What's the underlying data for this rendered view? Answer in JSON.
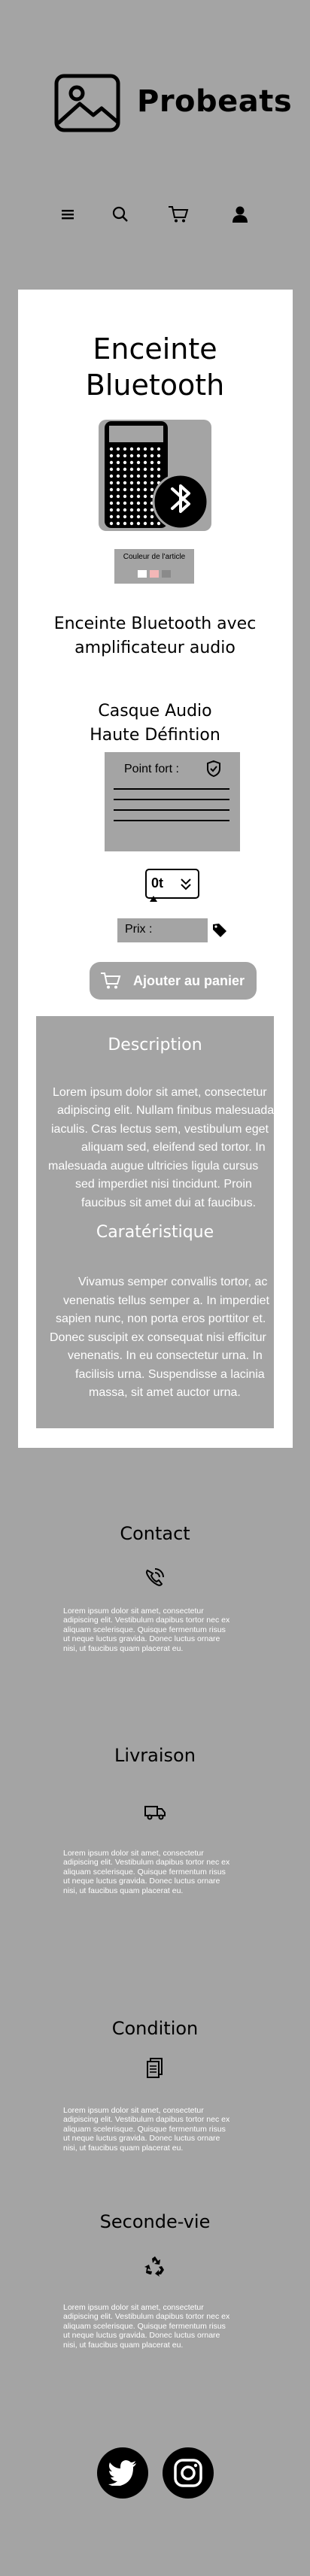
{
  "header": {
    "brand": "Probeats",
    "nav": [
      {
        "icon": "menu-icon"
      },
      {
        "icon": "search-icon"
      },
      {
        "icon": "cart-icon"
      },
      {
        "icon": "user-icon"
      }
    ]
  },
  "product": {
    "title_line1": "Enceinte",
    "title_line2": "Bluetooth",
    "image_icon": "bluetooth-speaker-icon",
    "color_label": "Couleur de l'article",
    "colors": [
      "#ffffff",
      "#f3b7b7",
      "#8a8a8a"
    ],
    "name_line1": "Enceinte Bluetooth avec",
    "name_line2": "amplificateur audio",
    "suggestion_line1": "Casque Audio",
    "suggestion_line2": "Haute Défintion",
    "point_fort_label": "Point fort :",
    "quantity_value": "0t",
    "price_label": "Prix :",
    "add_to_cart": "Ajouter au panier"
  },
  "description": {
    "title": "Description",
    "lines": [
      "Lorem ipsum dolor sit amet, consectetur",
      "adipiscing elit. Nullam finibus malesuada",
      "iaculis. Cras lectus sem, vestibulum eget",
      "aliquam sed, eleifend sed tortor. In",
      "malesuada augue ultricies ligula cursus",
      "sed imperdiet nisi tincidunt. Proin",
      "faucibus sit amet dui at faucibus."
    ],
    "char_title": "Caratéristique",
    "char_lines": [
      "Vivamus semper convallis tortor, ac",
      "venenatis tellus semper a. In imperdiet",
      "sapien nunc, non porta eros porttitor et.",
      "Donec suscipit ex consequat nisi efficitur",
      "venenatis. In eu consectetur urna. In",
      "facilisis urna. Suspendisse a lacinia",
      "massa, sit amet auctor urna."
    ]
  },
  "footer": {
    "sections": [
      {
        "title": "Contact",
        "icon": "phone-icon"
      },
      {
        "title": "Livraison",
        "icon": "truck-icon"
      },
      {
        "title": "Condition",
        "icon": "document-icon"
      },
      {
        "title": "Seconde-vie",
        "icon": "recycle-icon"
      }
    ],
    "lorem_lines": [
      "Lorem ipsum dolor sit amet, consectetur",
      "adipiscing elit. Vestibulum dapibus tortor nec ex",
      "aliquam scelerisque. Quisque fermentum risus",
      "ut neque luctus gravida. Donec luctus ornare",
      "nisi, ut faucibus quam placerat eu."
    ],
    "social": [
      {
        "icon": "twitter-icon"
      },
      {
        "icon": "instagram-icon"
      }
    ]
  }
}
